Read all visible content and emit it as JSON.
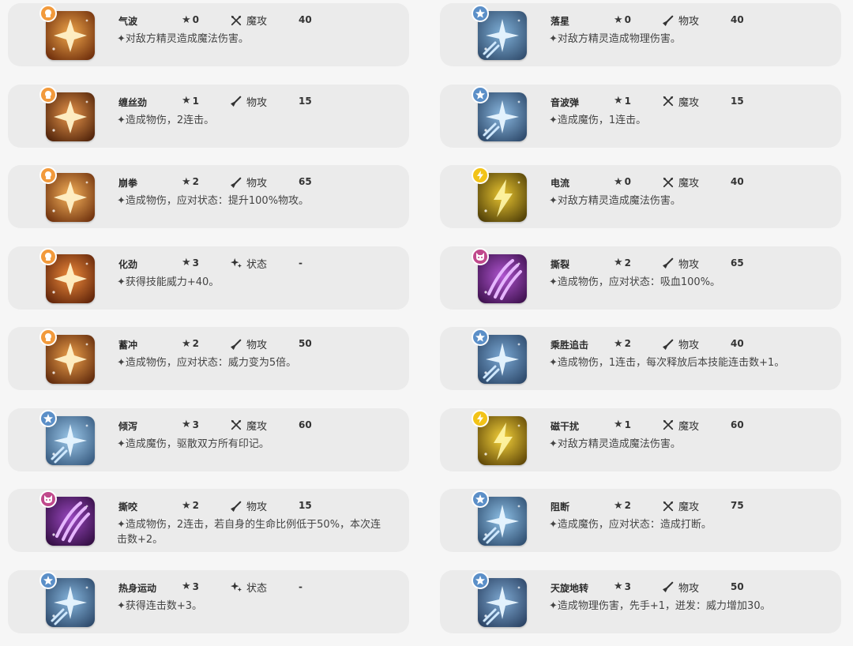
{
  "skills": [
    {
      "name": "气波",
      "stars": "0",
      "type": "魔攻",
      "power": "40",
      "desc": "✦对敌方精灵造成魔法伤害。",
      "element": "fighting",
      "icon": "energy-wave-icon",
      "colors": [
        "#f0a64a",
        "#6a2a0a"
      ]
    },
    {
      "name": "落星",
      "stars": "0",
      "type": "物攻",
      "power": "40",
      "desc": "✦对敌方精灵造成物理伤害。",
      "element": "normal",
      "icon": "falling-star-icon",
      "colors": [
        "#7fb0d8",
        "#2f4a6a"
      ]
    },
    {
      "name": "缠丝劲",
      "stars": "1",
      "type": "物攻",
      "power": "15",
      "desc": "✦造成物伤，2连击。",
      "element": "fighting",
      "icon": "silk-strike-icon",
      "colors": [
        "#e8954a",
        "#4a1f08"
      ]
    },
    {
      "name": "音波弹",
      "stars": "1",
      "type": "魔攻",
      "power": "15",
      "desc": "✦造成魔伤，1连击。",
      "element": "normal",
      "icon": "sound-wave-icon",
      "colors": [
        "#8ab8e0",
        "#2a4566"
      ]
    },
    {
      "name": "崩拳",
      "stars": "2",
      "type": "物攻",
      "power": "65",
      "desc": "✦造成物伤，应对状态：提升100%物攻。",
      "element": "fighting",
      "icon": "burst-fist-icon",
      "colors": [
        "#f7b25a",
        "#6a2d0b"
      ]
    },
    {
      "name": "电流",
      "stars": "0",
      "type": "魔攻",
      "power": "40",
      "desc": "✦对敌方精灵造成魔法伤害。",
      "element": "electric",
      "icon": "electric-current-icon",
      "colors": [
        "#e9c531",
        "#4a3a06"
      ]
    },
    {
      "name": "化劲",
      "stars": "3",
      "type": "状态",
      "power": "-",
      "desc": "✦获得技能威力+40。",
      "element": "fighting",
      "icon": "diamond-force-icon",
      "colors": [
        "#f08a3a",
        "#5a2008"
      ]
    },
    {
      "name": "撕裂",
      "stars": "2",
      "type": "物攻",
      "power": "65",
      "desc": "✦造成物伤，应对状态：吸血100%。",
      "element": "dark",
      "icon": "tear-icon",
      "colors": [
        "#b055d0",
        "#3a0f4a"
      ]
    },
    {
      "name": "蓄冲",
      "stars": "2",
      "type": "物攻",
      "power": "50",
      "desc": "✦造成物伤，应对状态：威力变为5倍。",
      "element": "fighting",
      "icon": "charge-rush-icon",
      "colors": [
        "#eea04a",
        "#5a250a"
      ]
    },
    {
      "name": "乘胜追击",
      "stars": "2",
      "type": "物攻",
      "power": "40",
      "desc": "✦造成物伤，1连击，每次释放后本技能连击数+1。",
      "element": "normal",
      "icon": "pursuit-icon",
      "colors": [
        "#7aa8d4",
        "#2a4566"
      ]
    },
    {
      "name": "倾泻",
      "stars": "3",
      "type": "魔攻",
      "power": "60",
      "desc": "✦造成魔伤，驱散双方所有印记。",
      "element": "normal",
      "icon": "pour-star-icon",
      "colors": [
        "#9cc8ea",
        "#34577c"
      ]
    },
    {
      "name": "磁干扰",
      "stars": "1",
      "type": "魔攻",
      "power": "60",
      "desc": "✦对敌方精灵造成魔法伤害。",
      "element": "electric",
      "icon": "magnetic-interference-icon",
      "colors": [
        "#f5d23a",
        "#5a4206"
      ]
    },
    {
      "name": "撕咬",
      "stars": "2",
      "type": "物攻",
      "power": "15",
      "desc": "✦造成物伤，2连击，若自身的生命比例低于50%，本次连击数+2。",
      "element": "dark",
      "icon": "bite-icon",
      "colors": [
        "#9a48c0",
        "#2f0c3e"
      ]
    },
    {
      "name": "阻断",
      "stars": "2",
      "type": "魔攻",
      "power": "75",
      "desc": "✦造成魔伤，应对状态：造成打断。",
      "element": "normal",
      "icon": "block-comet-icon",
      "colors": [
        "#8ec0e6",
        "#2c4a6c"
      ]
    },
    {
      "name": "热身运动",
      "stars": "3",
      "type": "状态",
      "power": "-",
      "desc": "✦获得连击数+3。",
      "element": "normal",
      "icon": "warm-up-icon",
      "colors": [
        "#86b6de",
        "#2a4566"
      ]
    },
    {
      "name": "天旋地转",
      "stars": "3",
      "type": "物攻",
      "power": "50",
      "desc": "✦造成物理伤害，先手+1，迸发：威力增加30。",
      "element": "normal",
      "icon": "spin-around-icon",
      "colors": [
        "#7ea9d2",
        "#283f60"
      ]
    }
  ],
  "element_colors": {
    "fighting": "#f29a3c",
    "normal": "#5b8fc8",
    "electric": "#f2c318",
    "dark": "#c0498c"
  }
}
